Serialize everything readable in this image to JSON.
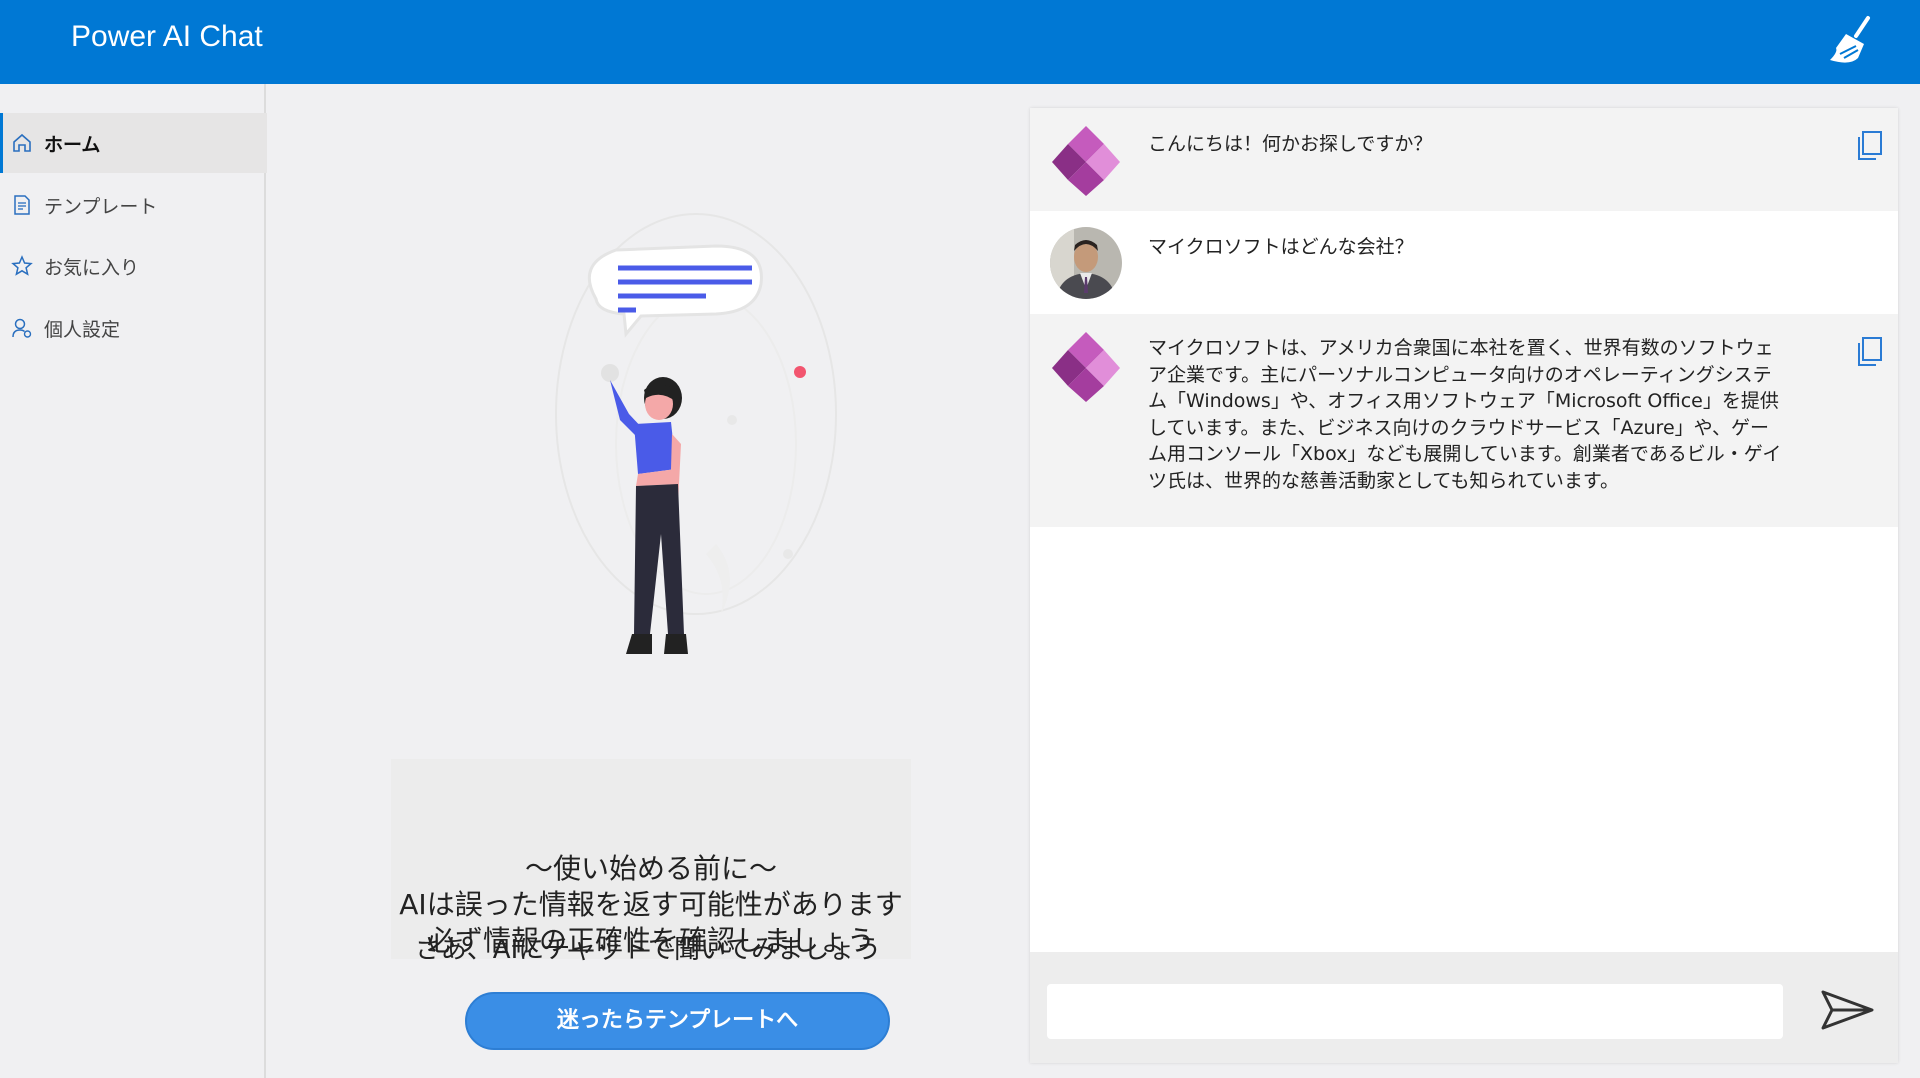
{
  "app": {
    "title": "Power AI Chat",
    "clear_icon": "broom-icon"
  },
  "sidebar": {
    "items": [
      {
        "label": "ホーム",
        "icon": "home-icon",
        "active": true
      },
      {
        "label": "テンプレート",
        "icon": "document-icon",
        "active": false
      },
      {
        "label": "お気に入り",
        "icon": "star-icon",
        "active": false
      },
      {
        "label": "個人設定",
        "icon": "person-settings-icon",
        "active": false
      }
    ]
  },
  "main": {
    "notice_lines": [
      "～使い始める前に～",
      "AIは誤った情報を返す可能性があります",
      "必ず情報の正確性を確認しましょう"
    ],
    "subtext": "さあ、AIにチャットで聞いてみましょう",
    "cta_label": "迷ったらテンプレートへ"
  },
  "chat": {
    "messages": [
      {
        "role": "bot",
        "text": "こんにちは！何かお探しですか？"
      },
      {
        "role": "user",
        "text": "マイクロソフトはどんな会社？"
      },
      {
        "role": "bot",
        "lines": [
          "マイクロソフトは、アメリカ合衆国に本社を置く、世界有数のソフトウェ",
          "ア企業です。主にパーソナルコンピュータ向けのオペレーティングシステ",
          "ム「Windows」や、オフィス用ソフトウェア「Microsoft Office」を提供",
          "しています。また、ビジネス向けのクラウドサービス「Azure」や、ゲー",
          "ム用コンソール「Xbox」なども展開しています。創業者であるビル・ゲイ",
          "ツ氏は、世界的な慈善活動家としても知られています。"
        ]
      }
    ],
    "input": {
      "value": "",
      "placeholder": ""
    },
    "send_icon": "send-icon",
    "copy_icon": "copy-icon"
  },
  "colors": {
    "header": "#0078d4",
    "cta": "#3a8ee6",
    "bot_logo_1": "#a43d9e",
    "bot_logo_2": "#e18ed9"
  }
}
